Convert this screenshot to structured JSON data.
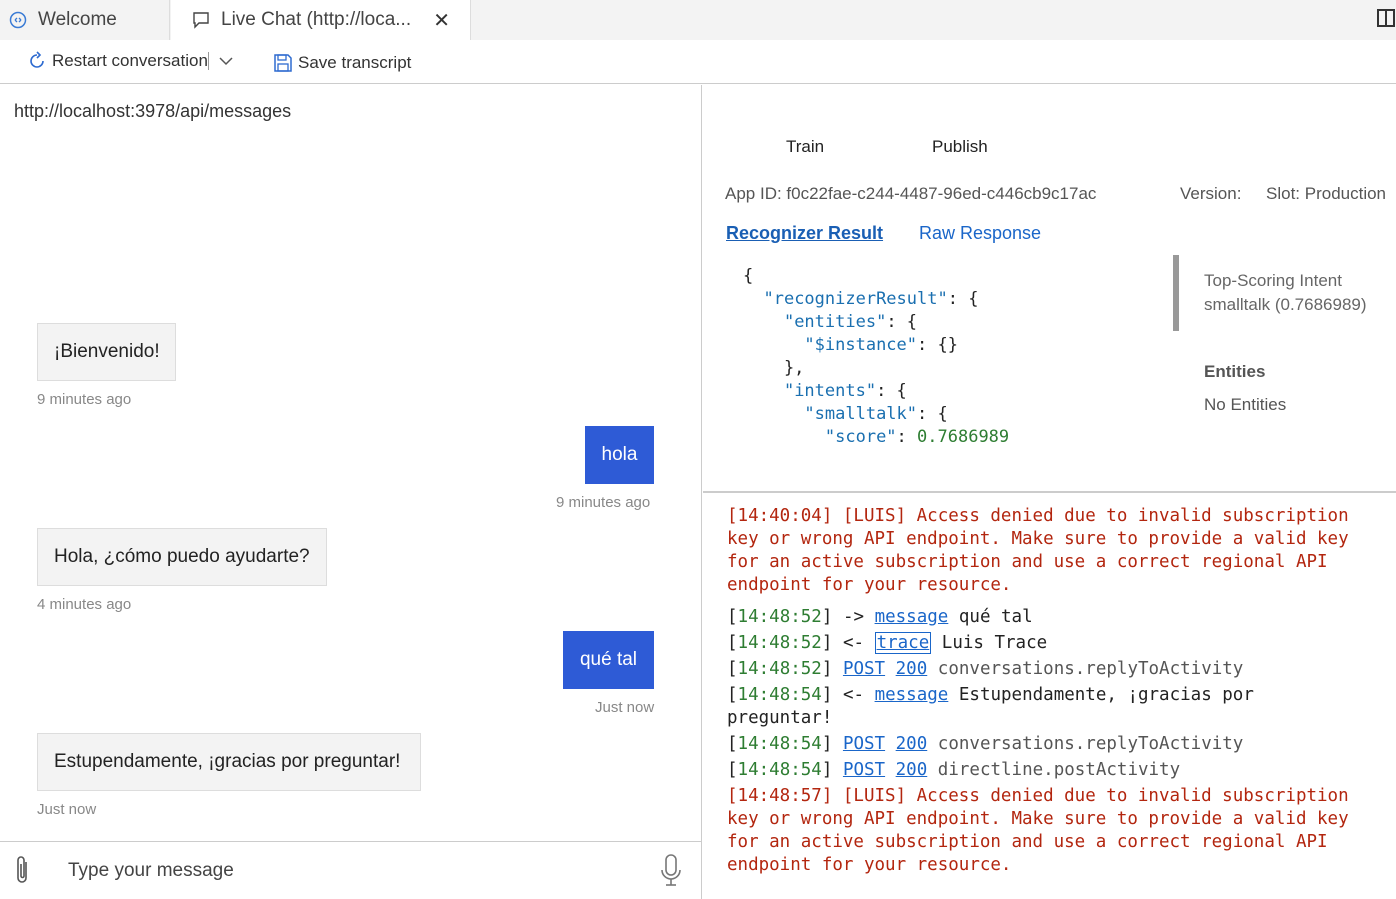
{
  "tabs": [
    {
      "label": "Welcome"
    },
    {
      "label": "Live Chat (http://loca..."
    }
  ],
  "toolbar": {
    "restart_label": "Restart conversation",
    "save_label": "Save transcript"
  },
  "chat": {
    "endpoint": "http://localhost:3978/api/messages",
    "messages": [
      {
        "from": "bot",
        "text": "¡Bienvenido!",
        "time": "9 minutes ago"
      },
      {
        "from": "user",
        "text": "hola",
        "time": "9 minutes ago"
      },
      {
        "from": "bot",
        "text": "Hola, ¿cómo puedo ayudarte?",
        "time": "4 minutes ago"
      },
      {
        "from": "user",
        "text": "qué tal",
        "time": "Just now"
      },
      {
        "from": "bot",
        "text": "Estupendamente, ¡gracias por preguntar!",
        "time": "Just now"
      }
    ],
    "composer_placeholder": "Type your message"
  },
  "inspector": {
    "train_label": "Train",
    "publish_label": "Publish",
    "app_id": "App ID: f0c22fae-c244-4487-96ed-c446cb9c17ac",
    "version": "Version:",
    "slot": "Slot: Production",
    "tab_recognizer": "Recognizer Result",
    "tab_raw": "Raw Response",
    "json_lines": [
      "{",
      "  \"recognizerResult\": {",
      "    \"entities\": {",
      "      \"$instance\": {}",
      "    },",
      "    \"intents\": {",
      "      \"smalltalk\": {",
      "        \"score\": 0.7686989"
    ],
    "top_intent_title": "Top-Scoring Intent",
    "top_intent_value": "smalltalk (0.7686989)",
    "entities_title": "Entities",
    "entities_value": "No Entities"
  },
  "log": {
    "partial_top": "[14:40:04] [LUIS] Access denied due to invalid subscription key or wrong API endpoint. Make sure to provide a valid key for an active subscription and use a correct regional API endpoint for your resource.",
    "entries": [
      {
        "time": "[14:48:52]",
        "arrow": "->",
        "link": "message",
        "text": "qué tal"
      },
      {
        "time": "[14:48:52]",
        "arrow": "<-",
        "link": "trace",
        "text": "Luis Trace"
      },
      {
        "time": "[14:48:52]",
        "method": "POST",
        "status": "200",
        "text": "conversations.replyToActivity"
      },
      {
        "time": "[14:48:54]",
        "arrow": "<-",
        "link": "message",
        "text": "Estupendamente, ¡gracias por preguntar!"
      },
      {
        "time": "[14:48:54]",
        "method": "POST",
        "status": "200",
        "text": "conversations.replyToActivity"
      },
      {
        "time": "[14:48:54]",
        "method": "POST",
        "status": "200",
        "text": "directline.postActivity"
      }
    ],
    "error_bottom": "[14:48:57] [LUIS] Access denied due to invalid subscription key or wrong API endpoint. Make sure to provide a valid key for an active subscription and use a correct regional API endpoint for your resource."
  }
}
